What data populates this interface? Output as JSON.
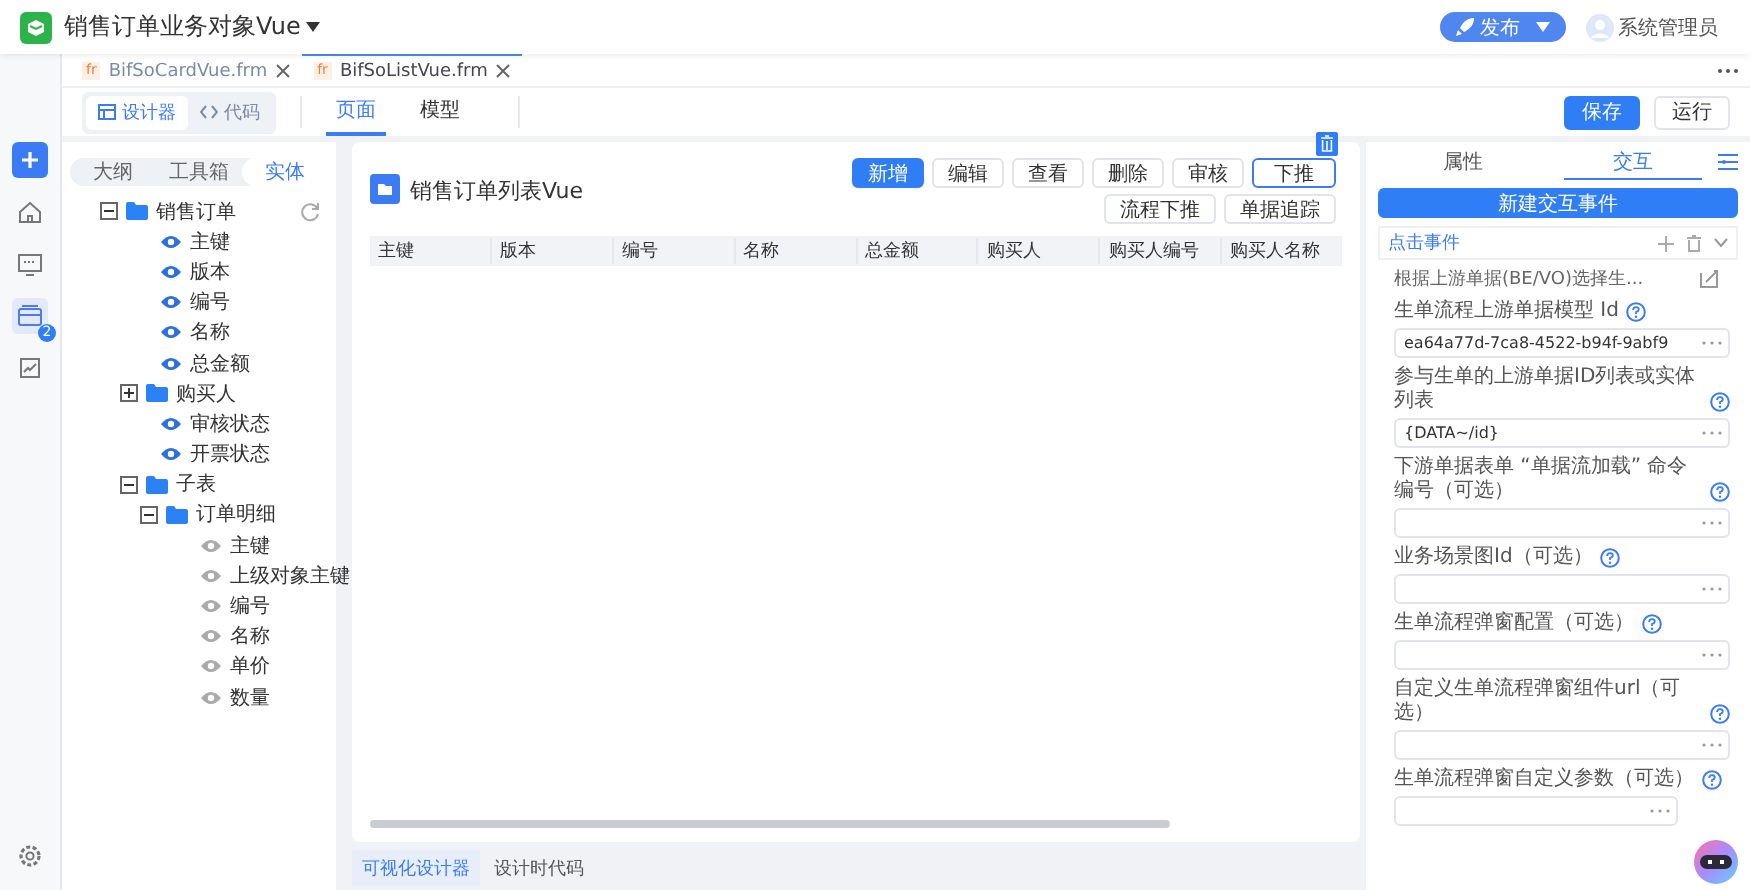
{
  "app": {
    "title": "销售订单业务对象Vue",
    "publish_button": "发布",
    "user": "系统管理员"
  },
  "rail": [
    {
      "kind": "add",
      "selected": false
    },
    {
      "kind": "home",
      "selected": false
    },
    {
      "kind": "monitor",
      "selected": false
    },
    {
      "kind": "cards",
      "selected": true,
      "badge": "2"
    },
    {
      "kind": "report",
      "selected": false
    }
  ],
  "file_tabs": [
    {
      "badge": "fr",
      "label": "BifSoCardVue.frm",
      "selected": false
    },
    {
      "badge": "fr",
      "label": "BifSoListVue.frm",
      "selected": true
    }
  ],
  "view_switch": [
    {
      "kind": "designer",
      "label": "设计器",
      "selected": true
    },
    {
      "kind": "code",
      "label": "代码",
      "selected": false
    }
  ],
  "page_tabs": [
    {
      "label": "页面",
      "selected": true
    },
    {
      "label": "模型",
      "selected": false
    }
  ],
  "actions": [
    {
      "kind": "primary",
      "label": "保存"
    },
    {
      "kind": "default",
      "label": "运行"
    }
  ],
  "left_panel": {
    "tabs": [
      {
        "label": "大纲",
        "selected": false
      },
      {
        "label": "工具箱",
        "selected": false
      },
      {
        "label": "实体",
        "selected": true
      }
    ],
    "tree": [
      {
        "kind": "folder",
        "label": "销售订单",
        "expanded": true,
        "children": [
          {
            "kind": "field",
            "label": "主键",
            "enabled": true
          },
          {
            "kind": "field",
            "label": "版本",
            "enabled": true
          },
          {
            "kind": "field",
            "label": "编号",
            "enabled": true
          },
          {
            "kind": "field",
            "label": "名称",
            "enabled": true
          },
          {
            "kind": "field",
            "label": "总金额",
            "enabled": true
          },
          {
            "kind": "folder",
            "label": "购买人",
            "expanded": false
          },
          {
            "kind": "field",
            "label": "审核状态",
            "enabled": true
          },
          {
            "kind": "field",
            "label": "开票状态",
            "enabled": true
          },
          {
            "kind": "folder",
            "label": "子表",
            "expanded": true,
            "children": [
              {
                "kind": "folder",
                "label": "订单明细",
                "expanded": true,
                "children": [
                  {
                    "kind": "field",
                    "label": "主键",
                    "enabled": false
                  },
                  {
                    "kind": "field",
                    "label": "上级对象主键",
                    "enabled": false
                  },
                  {
                    "kind": "field",
                    "label": "编号",
                    "enabled": false
                  },
                  {
                    "kind": "field",
                    "label": "名称",
                    "enabled": false
                  },
                  {
                    "kind": "field",
                    "label": "单价",
                    "enabled": false
                  },
                  {
                    "kind": "field",
                    "label": "数量",
                    "enabled": false
                  }
                ]
              }
            ]
          }
        ]
      }
    ]
  },
  "canvas": {
    "title": "销售订单列表Vue",
    "buttons": [
      {
        "kind": "primary",
        "label": "新增",
        "selected": false
      },
      {
        "kind": "default",
        "label": "编辑",
        "selected": false
      },
      {
        "kind": "default",
        "label": "查看",
        "selected": false
      },
      {
        "kind": "default",
        "label": "删除",
        "selected": false
      },
      {
        "kind": "default",
        "label": "审核",
        "selected": false
      },
      {
        "kind": "default",
        "label": "下推",
        "selected": true
      },
      {
        "kind": "default",
        "label": "流程下推",
        "selected": false
      },
      {
        "kind": "default",
        "label": "单据追踪",
        "selected": false
      }
    ],
    "columns": [
      "主键",
      "版本",
      "编号",
      "名称",
      "总金额",
      "购买人",
      "购买人编号",
      "购买人名称"
    ]
  },
  "right_panel": {
    "tabs": [
      {
        "label": "属性",
        "selected": false
      },
      {
        "label": "交互",
        "selected": true
      }
    ],
    "new_event_button": "新建交互事件",
    "event": {
      "title": "点击事件",
      "description": "根据上游单据(BE/VO)选择生..."
    },
    "fields": [
      {
        "label": "生单流程上游单据模型 Id",
        "value": "ea64a77d-7ca8-4522-b94f-9abf9"
      },
      {
        "label": "参与生单的上游单据ID列表或实体列表",
        "value": "{DATA~/id}"
      },
      {
        "label": "下游单据表单 “单据流加载” 命令编号（可选）"
      },
      {
        "label": "业务场景图Id（可选）"
      },
      {
        "label": "生单流程弹窗配置（可选）"
      },
      {
        "label": "自定义生单流程弹窗组件url（可选）"
      },
      {
        "label": "生单流程弹窗自定义参数（可选）"
      }
    ]
  },
  "bottom_tabs": [
    {
      "label": "可视化设计器",
      "selected": true
    },
    {
      "label": "设计时代码",
      "selected": false
    }
  ]
}
